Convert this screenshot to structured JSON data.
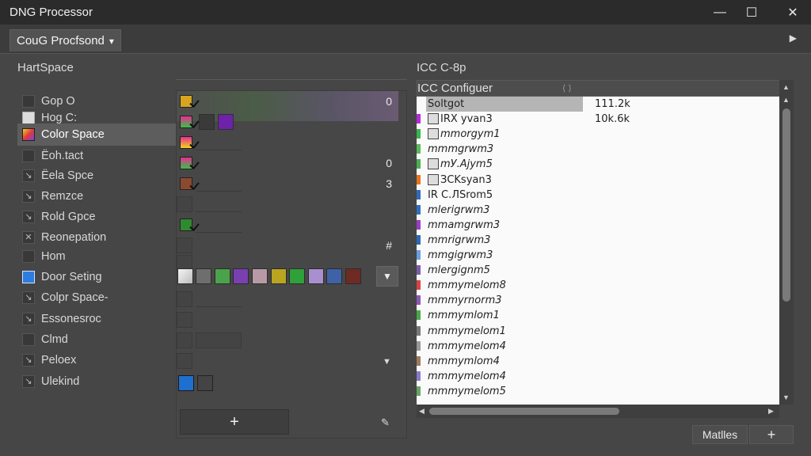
{
  "window": {
    "title": "DNG Processor",
    "minimize": "—",
    "maximize": "☐",
    "close": "✕"
  },
  "toolbar": {
    "dropdown_label": "CouG Procfsond",
    "dropdown_arrow": "▾",
    "play_icon": "▶"
  },
  "left": {
    "heading": "HartSpace",
    "items": [
      {
        "label": "Gop O",
        "icon": ""
      },
      {
        "label": "Hog C:",
        "icon": "chevron"
      },
      {
        "label": "Color Space",
        "icon": "color"
      },
      {
        "label": "Ёoh.tact",
        "icon": ""
      },
      {
        "label": "Ёela Spce",
        "icon": "x"
      },
      {
        "label": "Remzce",
        "icon": "x"
      },
      {
        "label": "Rold Gpce",
        "icon": "x"
      },
      {
        "label": "Reonepation",
        "icon": "x"
      },
      {
        "label": "Hom",
        "icon": ""
      },
      {
        "label": "Door Seting",
        "icon": "blue"
      },
      {
        "label": "Colpr Space-",
        "icon": "x"
      },
      {
        "label": "Essonesroc",
        "icon": "x"
      },
      {
        "label": "Clmd",
        "icon": ""
      },
      {
        "label": "Peloex",
        "icon": "x"
      },
      {
        "label": "Ulekind",
        "icon": "x"
      }
    ]
  },
  "middle": {
    "values": {
      "row0": "0",
      "row3": "0",
      "row4": "3",
      "row7": "#"
    },
    "swatch_dropdown_icon": "▼",
    "small_dropdown_icon": "▼",
    "add_label": "+",
    "edit_icon": "✎"
  },
  "right": {
    "heading": "ICC C-8p",
    "column_header": "ICC Configuer",
    "rows": [
      {
        "name": "Soltgot",
        "value": "111.2k",
        "color": "",
        "box": false,
        "italic": false
      },
      {
        "name": "IRX yvan3",
        "value": "10k.6k",
        "color": "#b42bd6",
        "box": true,
        "italic": false
      },
      {
        "name": "mmorgym1",
        "value": "",
        "color": "#39b54a",
        "box": true,
        "italic": true
      },
      {
        "name": "mmmgrwm3",
        "value": "",
        "color": "#5cb85c",
        "box": false,
        "italic": true
      },
      {
        "name": "mУ.Ajym5",
        "value": "",
        "color": "#4caf50",
        "box": true,
        "italic": true
      },
      {
        "name": "ЗCKsyan3",
        "value": "",
        "color": "#e8741e",
        "box": true,
        "italic": false
      },
      {
        "name": "IR C.ЛSrom5",
        "value": "",
        "color": "#3569b8",
        "box": false,
        "italic": false
      },
      {
        "name": "mlerigrwm3",
        "value": "",
        "color": "#2f6fc0",
        "box": false,
        "italic": true
      },
      {
        "name": "mmamgrwm3",
        "value": "",
        "color": "#9a3fc2",
        "box": false,
        "italic": true
      },
      {
        "name": "mmrigrwm3",
        "value": "",
        "color": "#2d68b5",
        "box": false,
        "italic": true
      },
      {
        "name": "mmgigrwm3",
        "value": "",
        "color": "#6b9ee0",
        "box": false,
        "italic": true
      },
      {
        "name": "mlergignm5",
        "value": "",
        "color": "#7b5ea8",
        "box": false,
        "italic": true
      },
      {
        "name": "mmmymelom8",
        "value": "",
        "color": "#d64545",
        "box": false,
        "italic": true
      },
      {
        "name": "mmmyrnorm3",
        "value": "",
        "color": "#8a5ab5",
        "box": false,
        "italic": true
      },
      {
        "name": "mmmymlom1",
        "value": "",
        "color": "#49a84a",
        "box": false,
        "italic": true
      },
      {
        "name": "mmmymelom1",
        "value": "",
        "color": "#777777",
        "box": false,
        "italic": true
      },
      {
        "name": "mmmymelom4",
        "value": "",
        "color": "#999999",
        "box": false,
        "italic": true
      },
      {
        "name": "mmmymlom4",
        "value": "",
        "color": "#9c7d5c",
        "box": false,
        "italic": true
      },
      {
        "name": "mmmymelom4",
        "value": "",
        "color": "#8a7bc8",
        "box": false,
        "italic": true
      },
      {
        "name": "mmmymelom5",
        "value": "",
        "color": "#6aa36a",
        "box": false,
        "italic": true
      }
    ],
    "matches_label": "Matlles",
    "add_label": "+"
  },
  "colors": {
    "swatches": [
      "#d9d9d9",
      "#6e6e6e",
      "#4aa34a",
      "#7a3fb0",
      "#b89aa6",
      "#b9a520",
      "#2fa13a",
      "#a98fd0",
      "#3f62a6",
      "#6f2a24"
    ]
  }
}
